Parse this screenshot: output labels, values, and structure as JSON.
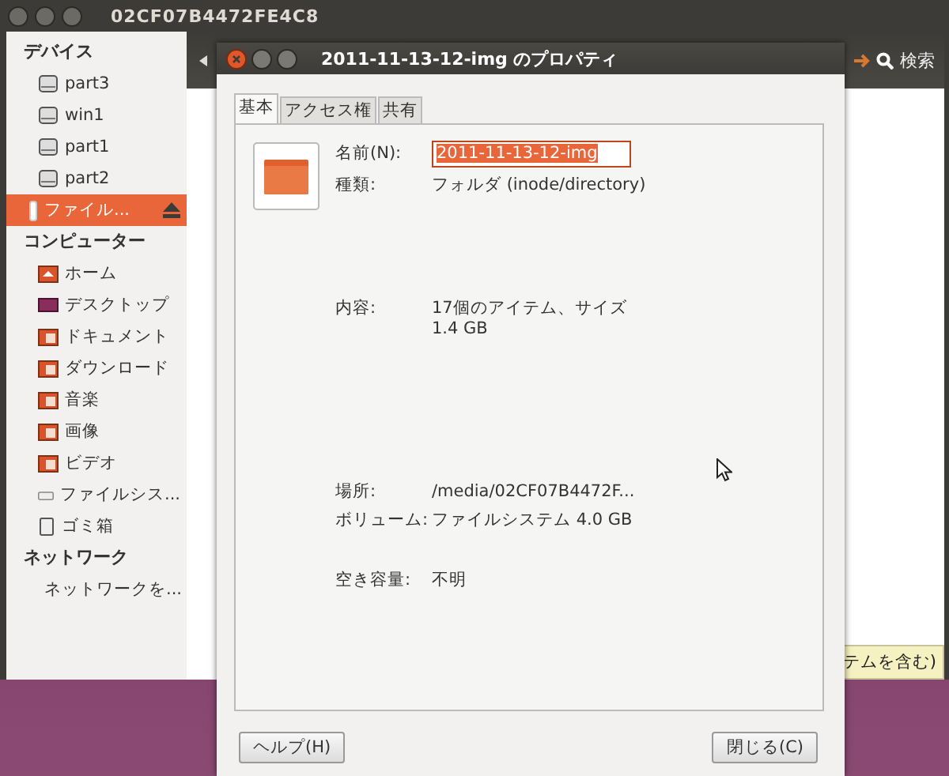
{
  "main_window": {
    "title": "02CF07B4472FE4C8",
    "search_label": "検索"
  },
  "sidebar": [
    {
      "title": "デバイス",
      "items": [
        {
          "label": "part3",
          "kind": "drive",
          "selected": false
        },
        {
          "label": "win1",
          "kind": "drive",
          "selected": false
        },
        {
          "label": "part1",
          "kind": "drive",
          "selected": false
        },
        {
          "label": "part2",
          "kind": "drive",
          "selected": false
        },
        {
          "label": "ファイル...",
          "kind": "usb",
          "selected": true
        }
      ]
    },
    {
      "title": "コンピューター",
      "items": [
        {
          "label": "ホーム",
          "kind": "home",
          "selected": false
        },
        {
          "label": "デスクトップ",
          "kind": "desktop",
          "selected": false
        },
        {
          "label": "ドキュメント",
          "kind": "folder",
          "selected": false
        },
        {
          "label": "ダウンロード",
          "kind": "folder",
          "selected": false
        },
        {
          "label": "音楽",
          "kind": "folder",
          "selected": false
        },
        {
          "label": "画像",
          "kind": "folder",
          "selected": false
        },
        {
          "label": "ビデオ",
          "kind": "folder",
          "selected": false
        },
        {
          "label": "ファイルシス...",
          "kind": "filesystem",
          "selected": false
        },
        {
          "label": "ゴミ箱",
          "kind": "trash",
          "selected": false
        }
      ]
    },
    {
      "title": "ネットワーク",
      "items": [
        {
          "label": "ネットワークを...",
          "kind": "network",
          "selected": false
        }
      ]
    }
  ],
  "tooltip": "テムを含む)",
  "dialog": {
    "title": "2011-11-13-12-img のプロパティ",
    "tabs": [
      {
        "label": "基本",
        "selected": true
      },
      {
        "label": "アクセス権",
        "selected": false
      },
      {
        "label": "共有",
        "selected": false
      }
    ],
    "name_label": "名前(N):",
    "name_value": "2011-11-13-12-img",
    "name_text_selected": true,
    "groups": [
      [
        {
          "label": "種類:",
          "value": "フォルダ (inode/directory)"
        }
      ],
      [
        {
          "label": "内容:",
          "value": "17個のアイテム、サイズ 1.4 GB"
        }
      ],
      [
        {
          "label": "場所:",
          "value": "/media/02CF07B4472F..."
        },
        {
          "label": "ボリューム:",
          "value": "ファイルシステム 4.0 GB"
        }
      ],
      [
        {
          "label": "空き容量:",
          "value": "不明"
        }
      ]
    ],
    "buttons": [
      {
        "label": "ヘルプ(H)"
      },
      {
        "label": "閉じる(C)"
      }
    ]
  }
}
